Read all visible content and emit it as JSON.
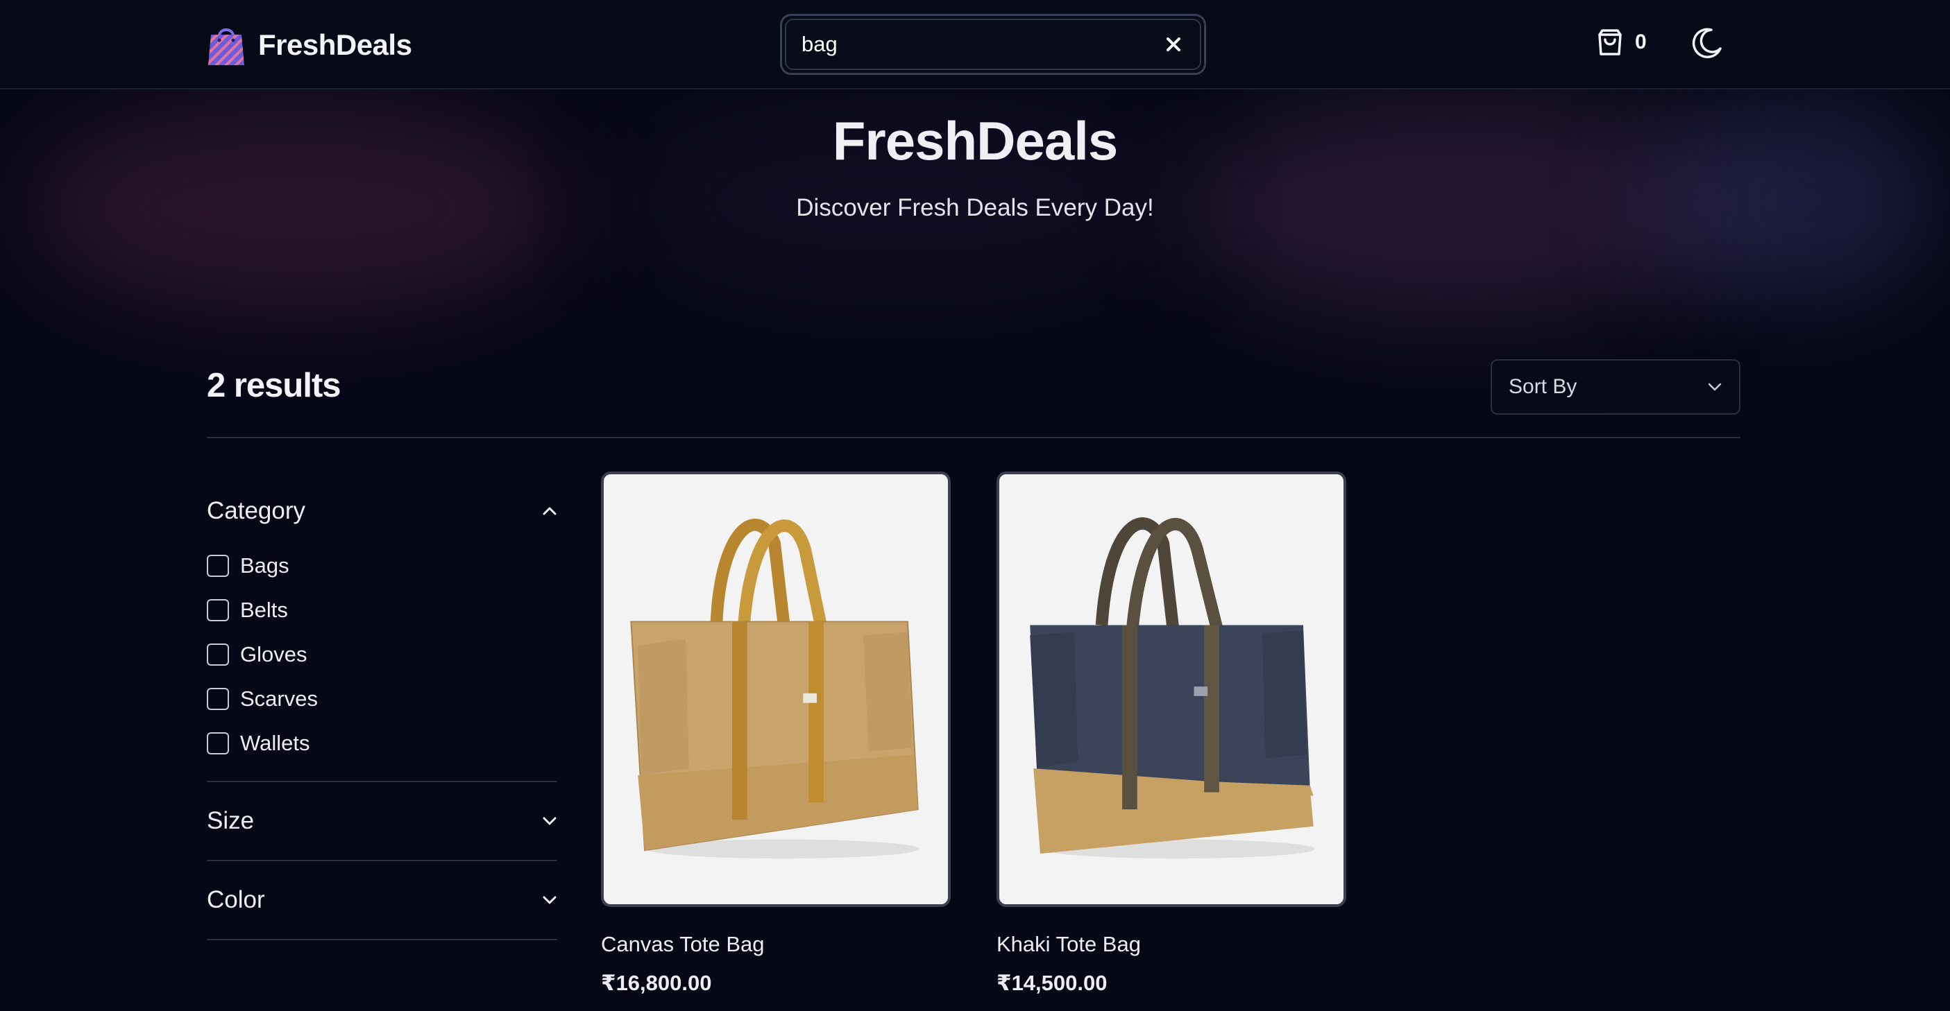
{
  "header": {
    "brand": "FreshDeals",
    "search": {
      "value": "bag"
    },
    "cart_count": "0",
    "icons": {
      "logo": "shopping-bag-icon",
      "clear": "close-icon",
      "cart": "shopping-bag-outline-icon",
      "theme": "moon-icon"
    }
  },
  "hero": {
    "title": "FreshDeals",
    "subtitle": "Discover Fresh Deals Every Day!"
  },
  "results_bar": {
    "count_text": "2 results",
    "sort_label": "Sort By"
  },
  "filters": {
    "category": {
      "title": "Category",
      "expanded": true,
      "options": [
        "Bags",
        "Belts",
        "Gloves",
        "Scarves",
        "Wallets"
      ]
    },
    "size": {
      "title": "Size",
      "expanded": false
    },
    "color": {
      "title": "Color",
      "expanded": false
    }
  },
  "products": [
    {
      "name": "Canvas Tote Bag",
      "price": "₹16,800.00",
      "color": "#c9a46c"
    },
    {
      "name": "Khaki Tote Bag",
      "price": "₹14,500.00",
      "color": "#3a4258"
    }
  ],
  "colors": {
    "background": "#060816",
    "border": "#2a2f42",
    "text": "#eceef4"
  }
}
